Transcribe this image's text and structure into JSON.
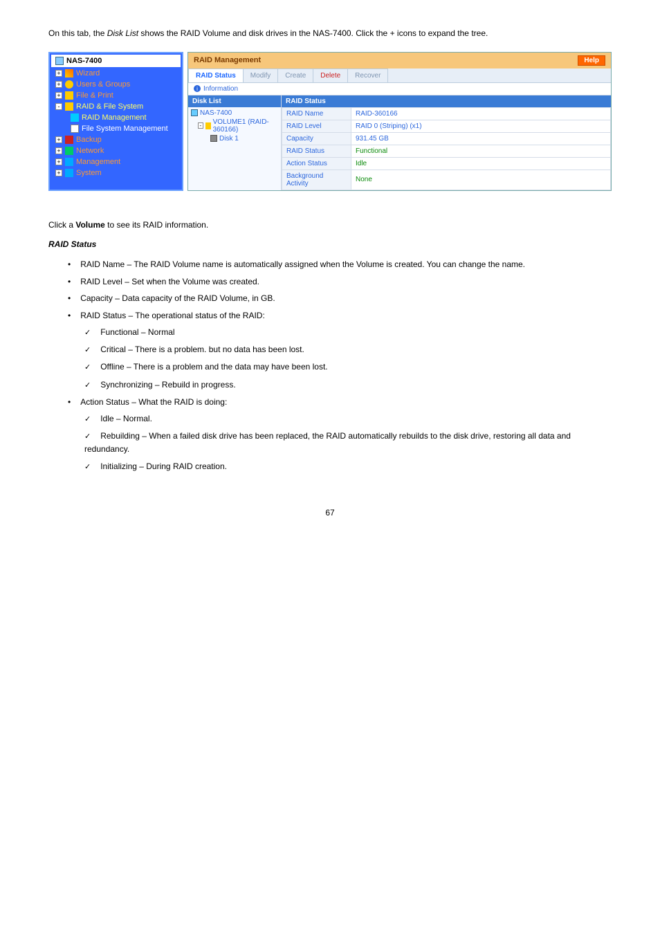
{
  "intro": {
    "p1_a": "On this tab, the ",
    "p1_b": "Disk List",
    "p1_c": " shows the RAID Volume and disk drives in the NAS-7400. Click the + icons to expand the tree."
  },
  "sidebar": {
    "header": "NAS-7400",
    "items": [
      {
        "toggle": "+",
        "icon": "wand",
        "label": "Wizard",
        "cls": "orange"
      },
      {
        "toggle": "+",
        "icon": "people",
        "label": "Users & Groups",
        "cls": "orange"
      },
      {
        "toggle": "+",
        "icon": "folder",
        "label": "File & Print",
        "cls": "orange"
      },
      {
        "toggle": "-",
        "icon": "raid",
        "label": "RAID & File System",
        "cls": "yellow"
      },
      {
        "toggle": "",
        "icon": "disk",
        "label": "RAID Management",
        "cls": "active",
        "sub": true
      },
      {
        "toggle": "",
        "icon": "file",
        "label": "File System Management",
        "cls": "white",
        "sub": true
      },
      {
        "toggle": "+",
        "icon": "backup",
        "label": "Backup",
        "cls": "orange"
      },
      {
        "toggle": "+",
        "icon": "net",
        "label": "Network",
        "cls": "orange"
      },
      {
        "toggle": "+",
        "icon": "mgmt",
        "label": "Management",
        "cls": "orange"
      },
      {
        "toggle": "+",
        "icon": "sys",
        "label": "System",
        "cls": "orange"
      }
    ]
  },
  "panel": {
    "title": "RAID Management",
    "help": "Help",
    "tabs": [
      "RAID Status",
      "Modify",
      "Create",
      "Delete",
      "Recover"
    ],
    "info": "Information",
    "disk_list_header": "Disk List",
    "tree": {
      "root": "NAS-7400",
      "vol": "VOLUME1 (RAID-360166)",
      "disk": "Disk 1"
    },
    "raid_status_header": "RAID Status",
    "rows": [
      {
        "label": "RAID Name",
        "value": "RAID-360166",
        "cls": ""
      },
      {
        "label": "RAID Level",
        "value": "RAID 0 (Striping) (x1)",
        "cls": ""
      },
      {
        "label": "Capacity",
        "value": "931.45 GB",
        "cls": ""
      },
      {
        "label": "RAID Status",
        "value": "Functional",
        "cls": "green"
      },
      {
        "label": "Action Status",
        "value": "Idle",
        "cls": "green"
      },
      {
        "label": "Background Activity",
        "value": "None",
        "cls": "green"
      }
    ]
  },
  "body": {
    "click_line_a": "Click a ",
    "click_line_b": "Volume",
    "click_line_c": " to see its RAID information.",
    "raid_status_title": "RAID Status",
    "items": [
      "RAID Name – The RAID Volume name is automatically assigned when the Volume is created. You can change the name.",
      "RAID Level – Set when the Volume was created.",
      "Capacity – Data capacity of the RAID Volume, in GB.",
      "RAID Status – The operational status of the RAID:"
    ],
    "status_checks": [
      "Functional – Normal",
      "Critical – There is a problem. but no data has been lost.",
      "Offline – There is a problem and the data may have been lost.",
      "Synchronizing – Rebuild in progress."
    ],
    "action_line": "Action Status – What the RAID is doing:",
    "action_checks": [
      "Idle – Normal.",
      "Rebuilding – When a failed disk drive has been replaced, the RAID automatically rebuilds to the disk drive, restoring all data and redundancy.",
      "Initializing – During RAID creation."
    ],
    "page_num": "67"
  }
}
